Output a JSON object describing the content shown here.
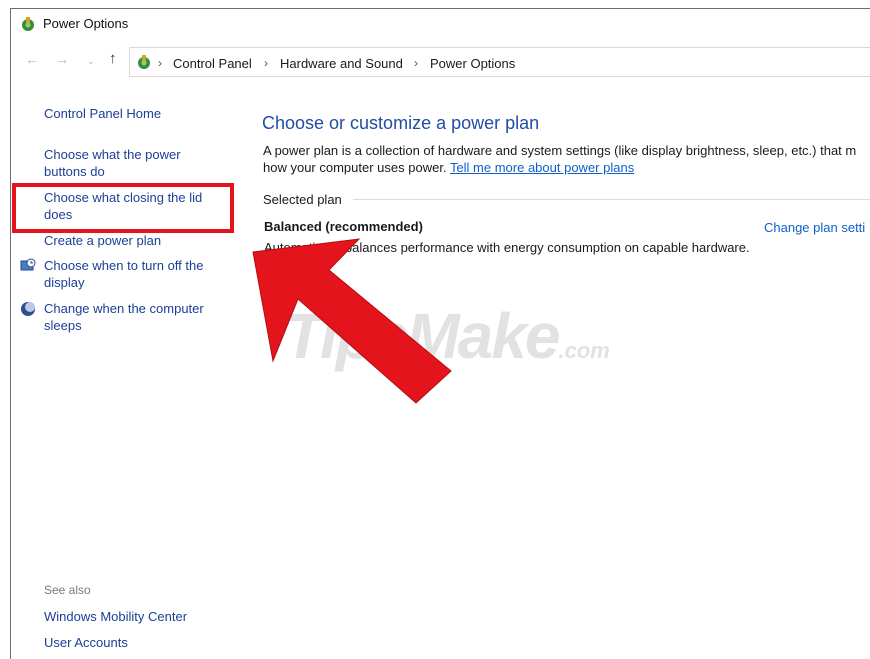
{
  "window": {
    "title": "Power Options"
  },
  "nav": {
    "back_glyph": "←",
    "forward_glyph": "→",
    "recent_glyph": "⌄",
    "up_glyph": "↑"
  },
  "breadcrumb": {
    "items": [
      "Control Panel",
      "Hardware and Sound",
      "Power Options"
    ],
    "separator": "›"
  },
  "sidebar": {
    "home": "Control Panel Home",
    "links": [
      "Choose what the power buttons do",
      "Choose what closing the lid does",
      "Create a power plan",
      "Choose when to turn off the display",
      "Change when the computer sleeps"
    ],
    "see_also_label": "See also",
    "see_also": [
      "Windows Mobility Center",
      "User Accounts"
    ]
  },
  "main": {
    "title": "Choose or customize a power plan",
    "description_1": "A power plan is a collection of hardware and system settings (like display brightness, sleep, etc.) that m",
    "description_2": "how your computer uses power.",
    "learn_more": "Tell me more about power plans",
    "selected_plan_label": "Selected plan",
    "plan_name": "Balanced (recommended)",
    "plan_desc": "Automatically balances performance with energy consumption on capable hardware.",
    "change_plan_link": "Change plan setti"
  },
  "watermark": {
    "brand": "TipsMake",
    "suffix": ".com"
  },
  "colors": {
    "link": "#1c3f95",
    "accent_red": "#e3141b",
    "title_blue": "#1f4ea3"
  }
}
